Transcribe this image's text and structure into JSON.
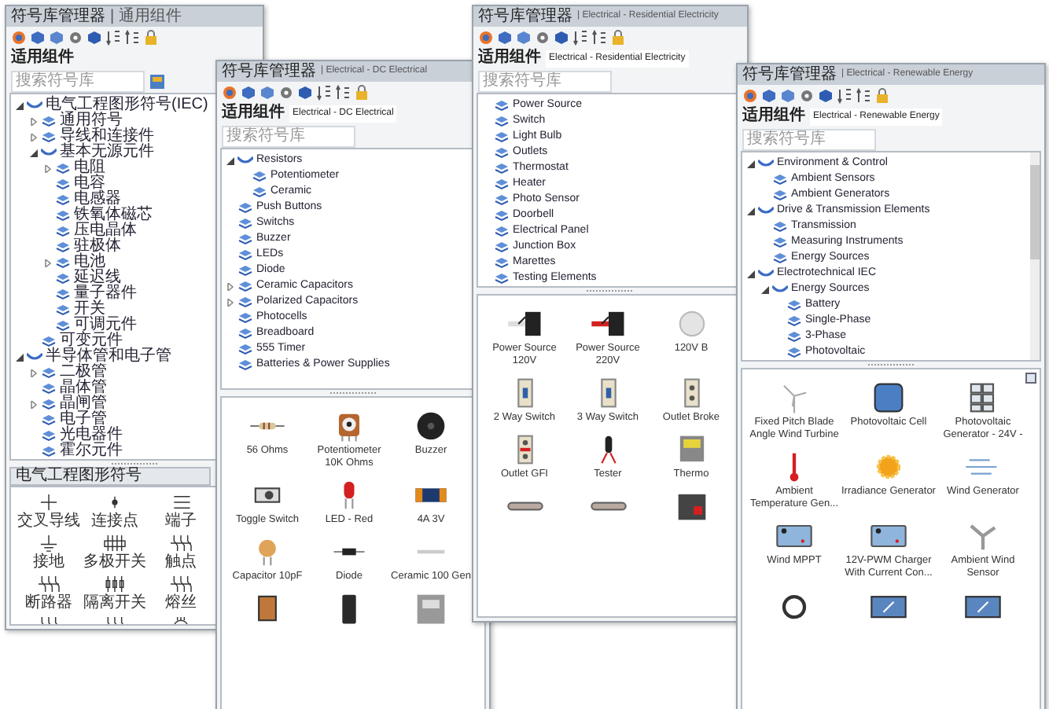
{
  "windows": [
    {
      "title": "符号库管理器",
      "title_detail": "| 通用组件",
      "library_label": "适用组件",
      "search": {
        "placeholder": "搜索符号库"
      },
      "tree": [
        {
          "label": "电气工程图形符号(IEC)",
          "expanded": true,
          "children": [
            {
              "label": "通用符号",
              "expanded": false
            },
            {
              "label": "导线和连接件",
              "expanded": false
            },
            {
              "label": "基本无源元件",
              "expanded": true,
              "children": [
                {
                  "label": "电阻",
                  "expanded": false
                },
                {
                  "label": "电容"
                },
                {
                  "label": "电感器"
                },
                {
                  "label": "铁氧体磁芯"
                },
                {
                  "label": "压电晶体"
                },
                {
                  "label": "驻极体"
                },
                {
                  "label": "电池",
                  "expanded": false
                },
                {
                  "label": "延迟线"
                },
                {
                  "label": "量子器件"
                },
                {
                  "label": "开关"
                },
                {
                  "label": "可调元件"
                }
              ]
            },
            {
              "label": "可变元件"
            }
          ]
        },
        {
          "label": "半导体管和电子管",
          "expanded": true,
          "children": [
            {
              "label": "二极管",
              "expanded": false
            },
            {
              "label": "晶体管"
            },
            {
              "label": "晶闸管",
              "expanded": false
            },
            {
              "label": "电子管"
            },
            {
              "label": "光电器件"
            },
            {
              "label": "霍尔元件"
            }
          ]
        }
      ],
      "gallery_header": "电气工程图形符号",
      "gallery": [
        {
          "kind": "cross",
          "label": "交叉导线"
        },
        {
          "kind": "node",
          "label": "连接点"
        },
        {
          "kind": "terminals",
          "label": "端子"
        },
        {
          "kind": "ground",
          "label": "接地"
        },
        {
          "kind": "switch-block",
          "label": "多极开关"
        },
        {
          "kind": "contacts",
          "label": "触点"
        },
        {
          "kind": "contacts",
          "label": "断路器"
        },
        {
          "kind": "fuses",
          "label": "隔离开关"
        },
        {
          "kind": "contacts",
          "label": "熔丝"
        },
        {
          "kind": "contacts"
        },
        {
          "kind": "contacts"
        },
        {
          "kind": "motor"
        }
      ]
    },
    {
      "title": "符号库管理器",
      "title_detail": "| Electrical - DC Electrical",
      "library_label": "适用组件",
      "library_value": "Electrical - DC Electrical",
      "search": {
        "placeholder": "搜索符号库"
      },
      "tree": [
        {
          "label": "Resistors",
          "expanded": true,
          "children": [
            {
              "label": "Potentiometer"
            },
            {
              "label": "Ceramic"
            }
          ]
        },
        {
          "label": "Push Buttons"
        },
        {
          "label": "Switchs"
        },
        {
          "label": "Buzzer"
        },
        {
          "label": "LEDs"
        },
        {
          "label": "Diode"
        },
        {
          "label": "Ceramic Capacitors",
          "expanded": false
        },
        {
          "label": "Polarized Capacitors",
          "expanded": false
        },
        {
          "label": "Photocells"
        },
        {
          "label": "Breadboard"
        },
        {
          "label": "555 Timer"
        },
        {
          "label": "Batteries & Power Supplies"
        }
      ],
      "gallery": [
        {
          "kind": "resistor",
          "label": "56 Ohms"
        },
        {
          "kind": "potentiometer",
          "label": "Potentiometer 10K Ohms"
        },
        {
          "kind": "buzzer",
          "label": "Buzzer"
        },
        {
          "kind": "toggle",
          "label": "Toggle Switch"
        },
        {
          "kind": "led",
          "label": "LED - Red"
        },
        {
          "kind": "battery",
          "label": "4A 3V"
        },
        {
          "kind": "capacitor",
          "label": "Capacitor 10pF"
        },
        {
          "kind": "diode",
          "label": "Diode"
        },
        {
          "kind": "wire",
          "label": "Ceramic 100 Gen"
        },
        {
          "kind": "photocell"
        },
        {
          "kind": "electrolytic"
        },
        {
          "kind": "meter"
        }
      ]
    },
    {
      "title": "符号库管理器",
      "title_detail": "| Electrical - Residential Electricity",
      "library_label": "适用组件",
      "library_value": "Electrical - Residential Electricity",
      "search": {
        "placeholder": "搜索符号库"
      },
      "tree": [
        {
          "label": "Power Source"
        },
        {
          "label": "Switch"
        },
        {
          "label": "Light Bulb"
        },
        {
          "label": "Outlets"
        },
        {
          "label": "Thermostat"
        },
        {
          "label": "Heater"
        },
        {
          "label": "Photo Sensor"
        },
        {
          "label": "Doorbell"
        },
        {
          "label": "Electrical Panel"
        },
        {
          "label": "Junction Box"
        },
        {
          "label": "Marettes"
        },
        {
          "label": "Testing Elements"
        }
      ],
      "gallery": [
        {
          "kind": "plug",
          "label": "Power Source 120V"
        },
        {
          "kind": "plug-red",
          "label": "Power Source 220V"
        },
        {
          "kind": "bulb",
          "label": "120V B"
        },
        {
          "kind": "wall-switch",
          "label": "2 Way Switch"
        },
        {
          "kind": "wall-switch",
          "label": "3 Way Switch"
        },
        {
          "kind": "outlet",
          "label": "Outlet Broke"
        },
        {
          "kind": "gfi",
          "label": "Outlet GFI"
        },
        {
          "kind": "tester",
          "label": "Tester"
        },
        {
          "kind": "thermostat",
          "label": "Thermo"
        },
        {
          "kind": "bar"
        },
        {
          "kind": "bar"
        },
        {
          "kind": "panel"
        }
      ]
    },
    {
      "title": "符号库管理器",
      "title_detail": "| Electrical - Renewable Energy",
      "library_label": "适用组件",
      "library_value": "Electrical - Renewable Energy",
      "search": {
        "placeholder": "搜索符号库"
      },
      "tree": [
        {
          "label": "Environment & Control",
          "expanded": true,
          "children": [
            {
              "label": "Ambient Sensors"
            },
            {
              "label": "Ambient Generators"
            }
          ]
        },
        {
          "label": "Drive & Transmission Elements",
          "expanded": true,
          "children": [
            {
              "label": "Transmission"
            },
            {
              "label": "Measuring Instruments"
            },
            {
              "label": "Energy Sources"
            }
          ]
        },
        {
          "label": "Electrotechnical IEC",
          "expanded": true,
          "children": [
            {
              "label": "Energy Sources",
              "expanded": true,
              "children": [
                {
                  "label": "Battery"
                },
                {
                  "label": "Single-Phase"
                },
                {
                  "label": "3-Phase"
                },
                {
                  "label": "Photovoltaic"
                }
              ]
            }
          ]
        }
      ],
      "gallery": [
        {
          "kind": "turbine",
          "label": "Fixed Pitch Blade Angle Wind Turbine"
        },
        {
          "kind": "pv-cell",
          "label": "Photovoltaic Cell"
        },
        {
          "kind": "pv-grid",
          "label": "Photovoltaic Generator - 24V -"
        },
        {
          "kind": "thermometer",
          "label": "Ambient Temperature Gen..."
        },
        {
          "kind": "sun",
          "label": "Irradiance Generator"
        },
        {
          "kind": "wind",
          "label": "Wind Generator"
        },
        {
          "kind": "controller",
          "label": "Wind MPPT"
        },
        {
          "kind": "controller",
          "label": "12V-PWM Charger With Current Con..."
        },
        {
          "kind": "anemometer",
          "label": "Ambient Wind Sensor"
        },
        {
          "kind": "ring"
        },
        {
          "kind": "converter"
        },
        {
          "kind": "converter"
        }
      ]
    }
  ]
}
